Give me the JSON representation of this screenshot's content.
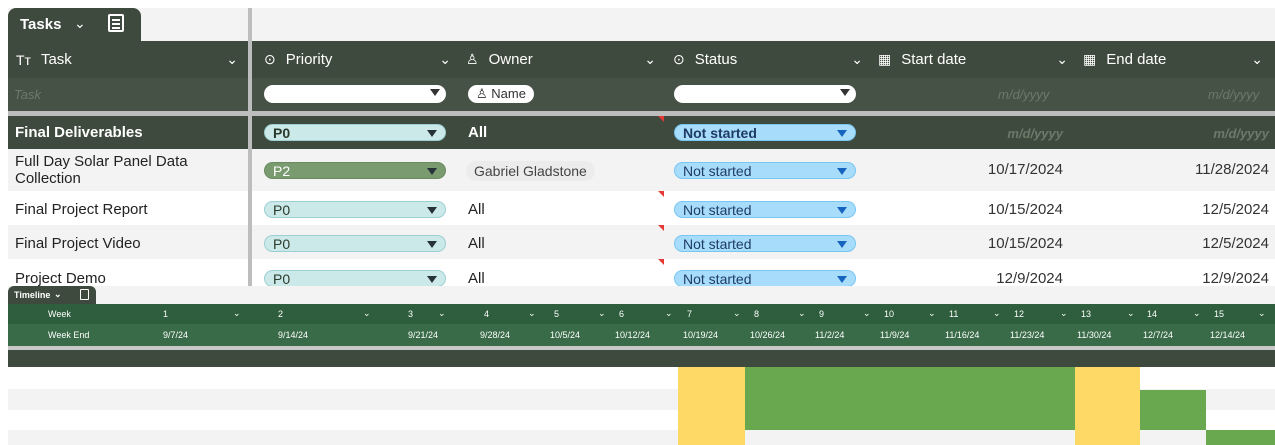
{
  "tab": {
    "title": "Tasks",
    "chevron": "⌄",
    "calc_icon": "calculator-icon"
  },
  "columns": [
    {
      "key": "task",
      "label": "Task",
      "icon": "Tт"
    },
    {
      "key": "priority",
      "label": "Priority",
      "icon": "⊙"
    },
    {
      "key": "owner",
      "label": "Owner",
      "icon": "♙"
    },
    {
      "key": "status",
      "label": "Status",
      "icon": "⊙"
    },
    {
      "key": "start",
      "label": "Start date",
      "icon": "▦"
    },
    {
      "key": "end",
      "label": "End date",
      "icon": "▦"
    }
  ],
  "filters": {
    "task_placeholder": "Task",
    "owner_chip": "Name",
    "date_placeholder": "m/d/yyyy"
  },
  "rows": [
    {
      "task": "Final Deliverables",
      "priority": "P0",
      "owner": "All",
      "status": "Not started",
      "start": "m/d/yyyy",
      "end": "m/d/yyyy"
    },
    {
      "task": "Full Day Solar Panel Data Collection",
      "priority": "P2",
      "owner": "Gabriel Gladstone",
      "status": "Not started",
      "start": "10/17/2024",
      "end": "11/28/2024"
    },
    {
      "task": "Final Project Report",
      "priority": "P0",
      "owner": "All",
      "status": "Not started",
      "start": "10/15/2024",
      "end": "12/5/2024"
    },
    {
      "task": "Final Project Video",
      "priority": "P0",
      "owner": "All",
      "status": "Not started",
      "start": "10/15/2024",
      "end": "12/5/2024"
    },
    {
      "task": "Project Demo",
      "priority": "P0",
      "owner": "All",
      "status": "Not started",
      "start": "12/9/2024",
      "end": "12/9/2024"
    }
  ],
  "timeline": {
    "tab_title": "Timeline",
    "week_label": "Week",
    "week_end_label": "Week End",
    "weeks": [
      "1",
      "2",
      "3",
      "4",
      "5",
      "6",
      "7",
      "8",
      "9",
      "10",
      "11",
      "12",
      "13",
      "14",
      "15"
    ],
    "week_ends": [
      "9/7/24",
      "9/14/24",
      "9/21/24",
      "9/28/24",
      "10/5/24",
      "10/12/24",
      "10/19/24",
      "10/26/24",
      "11/2/24",
      "11/9/24",
      "11/16/24",
      "11/23/24",
      "11/30/24",
      "12/7/24",
      "12/14/24"
    ]
  },
  "colors": {
    "header": "#3f4a3e",
    "timeline_header": "#2e5e3e",
    "bar_green": "#6aa84f",
    "bar_yellow": "#ffd966"
  }
}
